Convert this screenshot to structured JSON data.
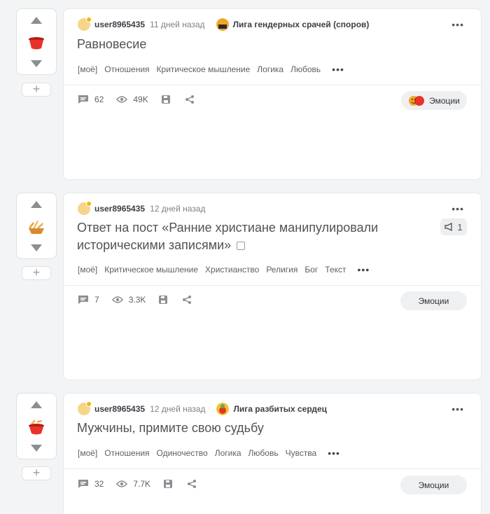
{
  "posts": [
    {
      "author": "user8965435",
      "time": "11 дней назад",
      "community": "Лига гендерных срачей (споров)",
      "title": "Равновесие",
      "tags": [
        "[моё]",
        "Отношения",
        "Критическое мышление",
        "Логика",
        "Любовь"
      ],
      "comments": "62",
      "views": "49K",
      "emotions_label": "Эмоции"
    },
    {
      "author": "user8965435",
      "time": "12 дней назад",
      "title_line1": "Ответ на пост «Ранние христиане манипулировали",
      "title_line2": "историческими записями»",
      "badge_count": "1",
      "tags": [
        "[моё]",
        "Критическое мышление",
        "Христианство",
        "Религия",
        "Бог",
        "Текст"
      ],
      "comments": "7",
      "views": "3.3K",
      "emotions_label": "Эмоции"
    },
    {
      "author": "user8965435",
      "time": "12 дней назад",
      "community": "Лига разбитых сердец",
      "title": "Мужчины, примите свою судьбу",
      "tags": [
        "[моё]",
        "Отношения",
        "Одиночество",
        "Логика",
        "Любовь",
        "Чувства"
      ],
      "comments": "32",
      "views": "7.7K",
      "emotions_label": "Эмоции"
    }
  ],
  "colors": {
    "accent": "#e8322a",
    "icon": "#8a8f94"
  }
}
